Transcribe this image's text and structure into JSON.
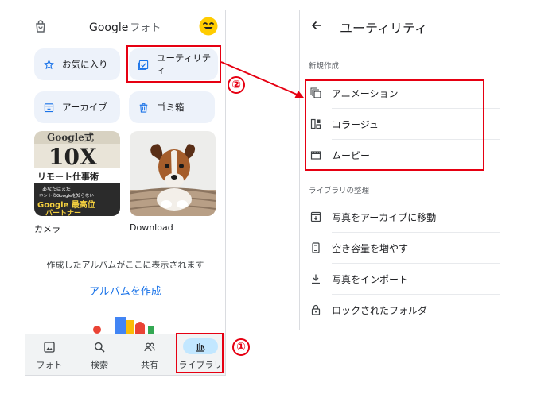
{
  "left_screen": {
    "app_title_google": "Google",
    "app_title_photos": "フォト",
    "chips": {
      "favorites": "お気に入り",
      "utility": "ユーティリティ",
      "archive": "アーカイブ",
      "trash": "ゴミ箱"
    },
    "albums": [
      {
        "label": "カメラ",
        "cover_lines": [
          "Google式",
          "10X",
          "リモート仕事術",
          "あなたはまだ",
          "ホントのGoogleを知らない",
          "Google 最高位",
          "パートナー"
        ]
      },
      {
        "label": "Download"
      }
    ],
    "empty_message": "作成したアルバムがここに表示されます",
    "create_album": "アルバムを作成",
    "bottom_nav": {
      "photos": "フォト",
      "search": "検索",
      "sharing": "共有",
      "library": "ライブラリ"
    }
  },
  "right_screen": {
    "title": "ユーティリティ",
    "section_create": "新規作成",
    "create_items": [
      "アニメーション",
      "コラージュ",
      "ムービー"
    ],
    "section_organize": "ライブラリの整理",
    "organize_items": [
      "写真をアーカイブに移動",
      "空き容量を増やす",
      "写真をインポート",
      "ロックされたフォルダ"
    ]
  },
  "annotations": {
    "step1": "①",
    "step2": "②",
    "color": "#e60012"
  },
  "colors": {
    "accent_blue": "#1a73e8",
    "chip_bg": "#edf2fa",
    "nav_active": "#c2e7ff"
  }
}
